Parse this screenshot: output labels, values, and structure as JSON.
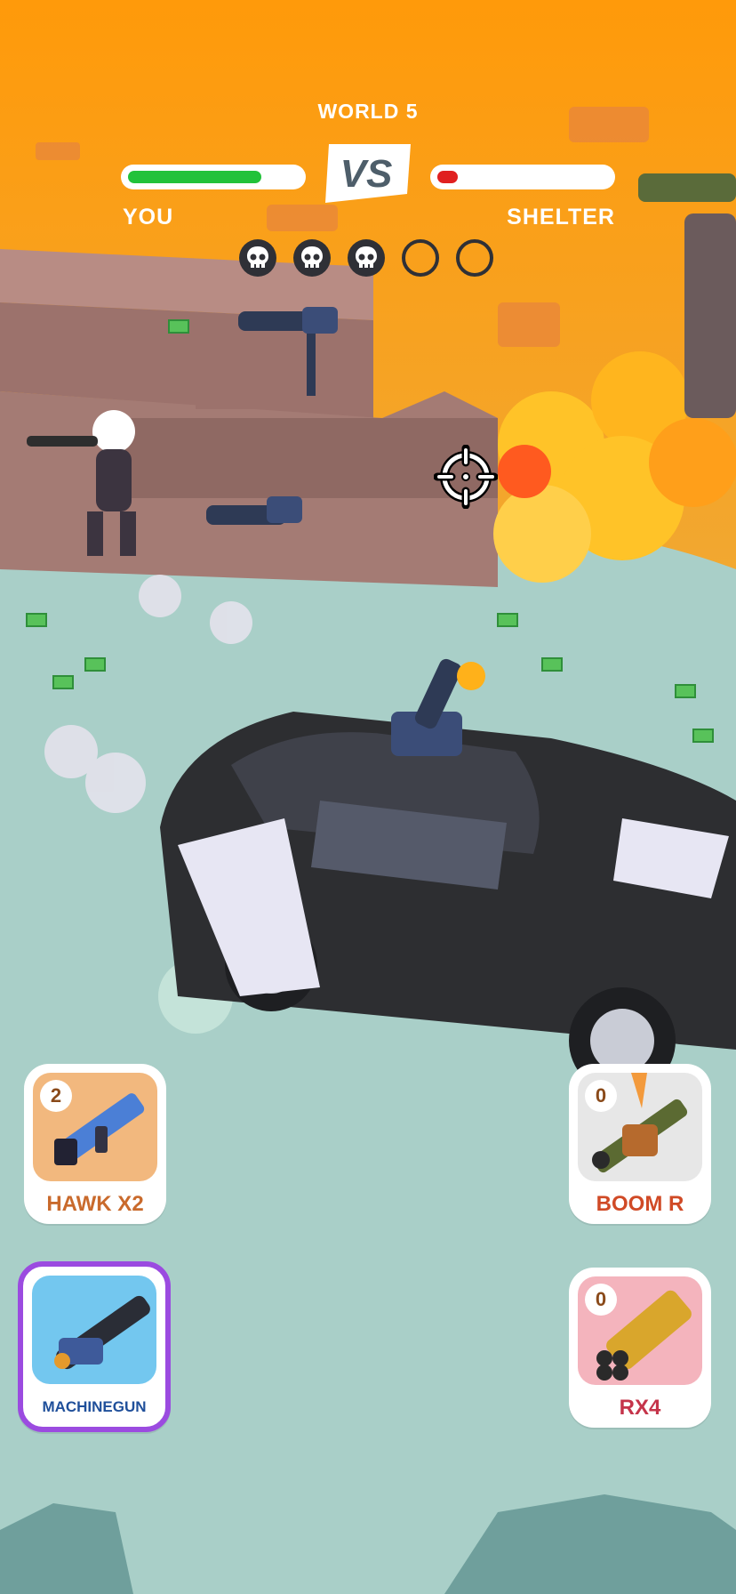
{
  "hud": {
    "world_label": "WORLD 5",
    "vs_label": "VS",
    "player": {
      "label": "YOU",
      "health": 0.78,
      "color": "#22c23a"
    },
    "enemy": {
      "label": "SHELTER",
      "health": 0.12,
      "color": "#e02020"
    },
    "kills": {
      "filled": 3,
      "total": 5
    }
  },
  "weapons": [
    {
      "id": "hawk",
      "name": "HAWK X2",
      "count": "2",
      "thumb_color": "#f2b87e",
      "selected": false
    },
    {
      "id": "boom",
      "name": "BOOM R",
      "count": "0",
      "thumb_color": "#e7e7e7",
      "selected": false
    },
    {
      "id": "machinegun",
      "name": "MACHINEGUN",
      "count": "",
      "thumb_color": "#73c7ef",
      "selected": true
    },
    {
      "id": "rx4",
      "name": "RX4",
      "count": "0",
      "thumb_color": "#f4b4bd",
      "selected": false
    }
  ],
  "colors": {
    "sky": "#ff9a0a",
    "ground": "#a9cfc8",
    "explosion": "#ffc328"
  }
}
